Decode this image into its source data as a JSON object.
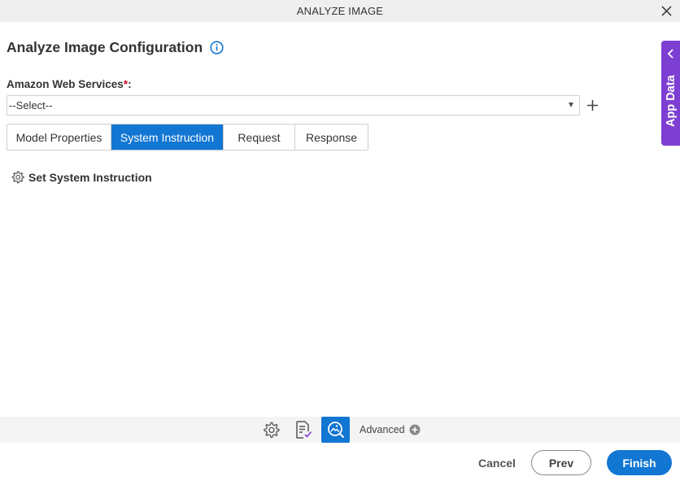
{
  "window": {
    "title": "ANALYZE IMAGE"
  },
  "heading": {
    "text": "Analyze Image Configuration"
  },
  "field": {
    "label": "Amazon Web Services",
    "required_mark": "*",
    "colon": ":",
    "selected_value": "--Select--"
  },
  "tabs": [
    {
      "label": "Model Properties",
      "active": false
    },
    {
      "label": "System Instruction",
      "active": true
    },
    {
      "label": "Request",
      "active": false
    },
    {
      "label": "Response",
      "active": false
    }
  ],
  "section": {
    "set_instruction_label": "Set System Instruction"
  },
  "side_panel": {
    "label": "App Data"
  },
  "bottom_bar": {
    "advanced_label": "Advanced"
  },
  "footer": {
    "cancel_label": "Cancel",
    "prev_label": "Prev",
    "finish_label": "Finish"
  },
  "colors": {
    "accent": "#1276d3",
    "app_data": "#7d3fd1",
    "required": "#d0021b"
  },
  "icons": {
    "close": "close-icon",
    "info": "info-icon",
    "add": "plus-icon",
    "gear": "gear-icon",
    "doc": "document-check-icon",
    "analyze": "image-analyze-icon",
    "advanced": "plus-circle-icon",
    "chevron": "chevron-left-icon"
  }
}
